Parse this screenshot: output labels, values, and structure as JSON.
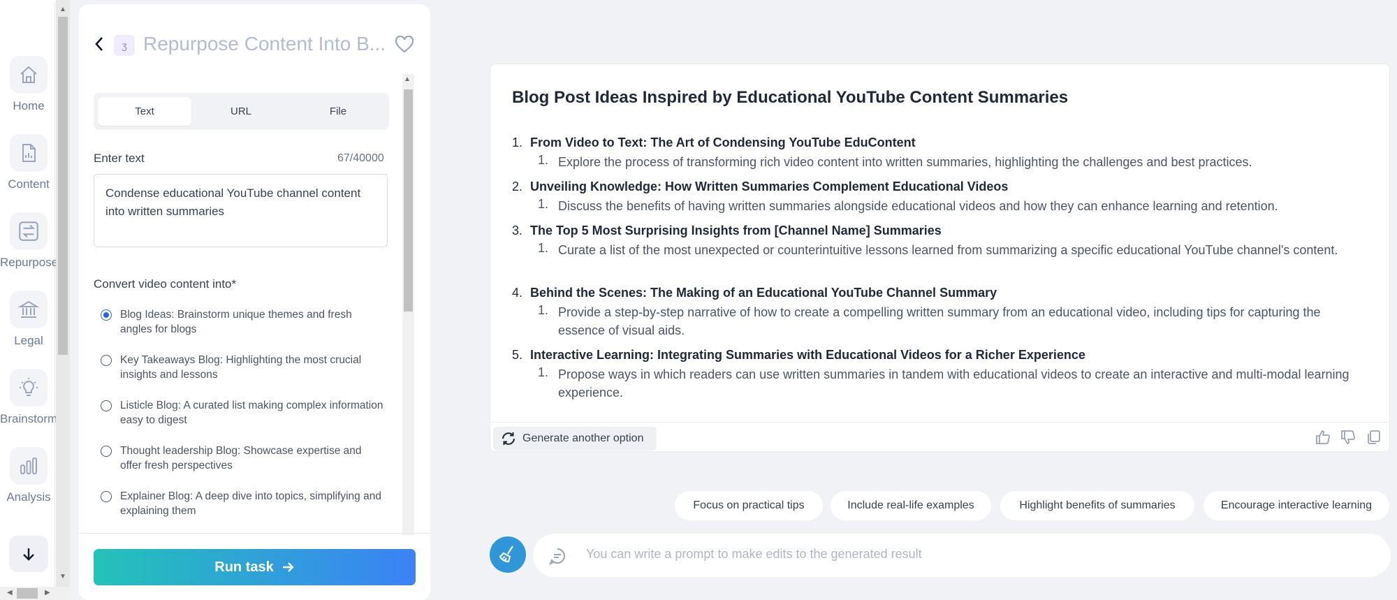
{
  "sidebar": {
    "items": [
      {
        "label": "Home",
        "icon": "home-icon"
      },
      {
        "label": "Content",
        "icon": "document-chart-icon"
      },
      {
        "label": "Repurpose",
        "icon": "swap-arrows-icon"
      },
      {
        "label": "Legal",
        "icon": "bank-icon"
      },
      {
        "label": "Brainstorm",
        "icon": "lightbulb-icon"
      },
      {
        "label": "Analysis",
        "icon": "bar-chart-icon"
      }
    ]
  },
  "panel": {
    "title": "Repurpose Content Into B...",
    "tool_badge": "ʒ",
    "tabs": [
      "Text",
      "URL",
      "File"
    ],
    "active_tab": "Text",
    "input_label": "Enter text",
    "char_count": "67/40000",
    "input_value": "Condense educational YouTube channel content into written summaries",
    "convert_label": "Convert video content into*",
    "options": [
      {
        "text": "Blog Ideas: Brainstorm unique themes and fresh angles for blogs",
        "checked": true
      },
      {
        "text": "Key Takeaways Blog: Highlighting the most crucial insights and lessons",
        "checked": false
      },
      {
        "text": "Listicle Blog: A curated list making complex information easy to digest",
        "checked": false
      },
      {
        "text": "Thought leadership Blog: Showcase expertise and offer fresh perspectives",
        "checked": false
      },
      {
        "text": "Explainer Blog: A deep dive into topics, simplifying and explaining them",
        "checked": false
      }
    ],
    "run_label": "Run task"
  },
  "result": {
    "title": "Blog Post Ideas Inspired by Educational YouTube Content Summaries",
    "items": [
      {
        "num": "1.",
        "heading": "From Video to Text: The Art of Condensing YouTube EduContent",
        "sub": "Explore the process of transforming rich video content into written summaries, highlighting the challenges and best practices."
      },
      {
        "num": "2.",
        "heading": "Unveiling Knowledge: How Written Summaries Complement Educational Videos",
        "sub": "Discuss the benefits of having written summaries alongside educational videos and how they can enhance learning and retention."
      },
      {
        "num": "3.",
        "heading": "The Top 5 Most Surprising Insights from [Channel Name] Summaries",
        "sub": "Curate a list of the most unexpected or counterintuitive lessons learned from summarizing a specific educational YouTube channel's content."
      },
      {
        "num": "4.",
        "heading": "Behind the Scenes: The Making of an Educational YouTube Channel Summary",
        "sub": "Provide a step-by-step narrative of how to create a compelling written summary from an educational video, including tips for capturing the essence of visual aids."
      },
      {
        "num": "5.",
        "heading": "Interactive Learning: Integrating Summaries with Educational Videos for a Richer Experience",
        "sub": "Propose ways in which readers can use written summaries in tandem with educational videos to create an interactive and multi-modal learning experience."
      }
    ],
    "sub_num": "1.",
    "generate_label": "Generate another option"
  },
  "chips": [
    "Focus on practical tips",
    "Include real-life examples",
    "Highlight benefits of summaries",
    "Encourage interactive learning"
  ],
  "prompt": {
    "placeholder": "You can write a prompt to make edits to the generated result"
  },
  "colors": {
    "accent": "#3b82f6",
    "teal": "#22c3b8",
    "radio": "#2563eb",
    "avatar": "#2f97d8"
  }
}
